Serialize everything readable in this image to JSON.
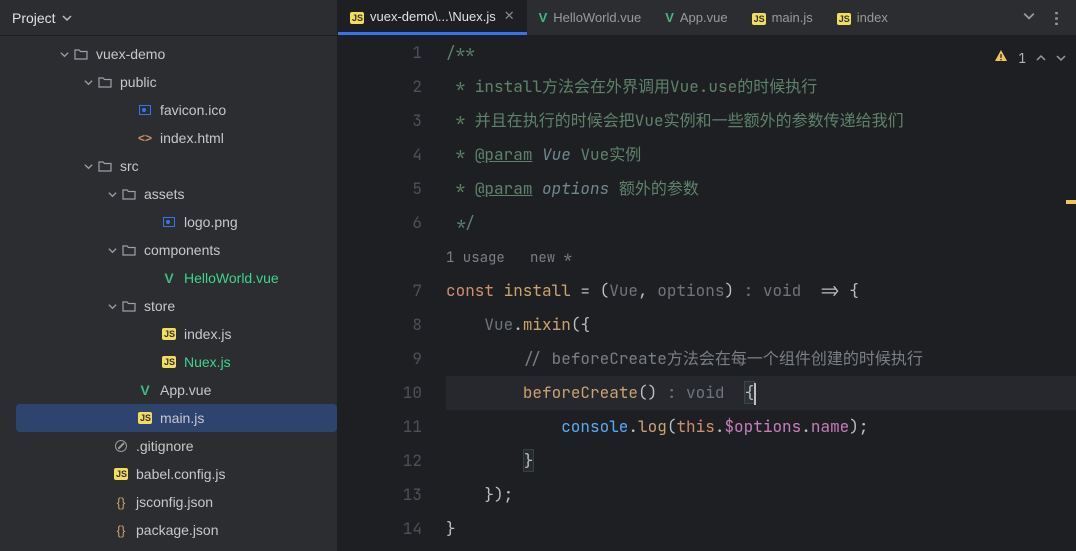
{
  "sidebar": {
    "title": "Project",
    "tree": [
      {
        "indent": 56,
        "chevron": "down",
        "icon": "folder",
        "label": "vuex-demo"
      },
      {
        "indent": 80,
        "chevron": "down",
        "icon": "folder",
        "label": "public"
      },
      {
        "indent": 120,
        "chevron": "",
        "icon": "img",
        "label": "favicon.ico"
      },
      {
        "indent": 120,
        "chevron": "",
        "icon": "html",
        "label": "index.html"
      },
      {
        "indent": 80,
        "chevron": "down",
        "icon": "folder",
        "label": "src"
      },
      {
        "indent": 104,
        "chevron": "down",
        "icon": "folder",
        "label": "assets"
      },
      {
        "indent": 144,
        "chevron": "",
        "icon": "img",
        "label": "logo.png"
      },
      {
        "indent": 104,
        "chevron": "down",
        "icon": "folder",
        "label": "components"
      },
      {
        "indent": 144,
        "chevron": "",
        "icon": "vue",
        "label": "HelloWorld.vue",
        "color": "vue"
      },
      {
        "indent": 104,
        "chevron": "down",
        "icon": "folder",
        "label": "store"
      },
      {
        "indent": 144,
        "chevron": "",
        "icon": "js",
        "label": "index.js"
      },
      {
        "indent": 144,
        "chevron": "",
        "icon": "js",
        "label": "Nuex.js",
        "color": "vue"
      },
      {
        "indent": 120,
        "chevron": "",
        "icon": "vue",
        "label": "App.vue"
      },
      {
        "indent": 120,
        "chevron": "",
        "icon": "js",
        "label": "main.js",
        "selected": true
      },
      {
        "indent": 96,
        "chevron": "",
        "icon": "gitignore",
        "label": ".gitignore"
      },
      {
        "indent": 96,
        "chevron": "",
        "icon": "js",
        "label": "babel.config.js"
      },
      {
        "indent": 96,
        "chevron": "",
        "icon": "json",
        "label": "jsconfig.json"
      },
      {
        "indent": 96,
        "chevron": "",
        "icon": "json",
        "label": "package.json"
      }
    ]
  },
  "tabs": {
    "items": [
      {
        "icon": "js",
        "label": "vuex-demo\\...\\Nuex.js",
        "active": true,
        "closeable": true
      },
      {
        "icon": "vue",
        "label": "HelloWorld.vue"
      },
      {
        "icon": "vue",
        "label": "App.vue"
      },
      {
        "icon": "js",
        "label": "main.js"
      },
      {
        "icon": "js",
        "label": "index"
      }
    ]
  },
  "status": {
    "warnings": "1"
  },
  "code": {
    "usage_hint": "1 usage   new *",
    "lines": [
      {
        "n": "1",
        "html": "<span class='c-comment'>/**</span>"
      },
      {
        "n": "2",
        "html": "<span class='c-comment'> * install方法会在外界调用Vue.use的时候执行</span>"
      },
      {
        "n": "3",
        "html": "<span class='c-comment'> * 并且在执行的时候会把Vue实例和一些额外的参数传递给我们</span>"
      },
      {
        "n": "4",
        "html": "<span class='c-comment'> * </span><span class='c-param'>@param</span><span class='c-comment'> </span><span class='c-param-type'>Vue</span><span class='c-comment'> Vue实例</span>"
      },
      {
        "n": "5",
        "html": "<span class='c-comment'> * </span><span class='c-param'>@param</span><span class='c-comment'> </span><span class='c-param-type'>options</span><span class='c-comment'> 额外的参数</span>"
      },
      {
        "n": "6",
        "html": "<span class='c-comment'> */</span>"
      },
      {
        "n": "",
        "usage": true
      },
      {
        "n": "7",
        "html": "<span class='c-keyword'>const </span><span class='c-fn'>install</span><span class='c-punc'> = (</span><span class='c-hint'>Vue</span><span class='c-punc'>, </span><span class='c-hint'>options</span><span class='c-punc'>)</span><span class='c-hint'> : void </span><span class='c-punc'> =&gt; {</span>"
      },
      {
        "n": "8",
        "html": "    <span class='c-hint'>Vue</span><span class='c-punc'>.</span><span class='c-method-y'>mixin</span><span class='c-punc'>({</span>"
      },
      {
        "n": "9",
        "html": "        <span class='c-line-comment'>// beforeCreate方法会在每一个组件创建的时候执行</span>"
      },
      {
        "n": "10",
        "highlighted": true,
        "html": "        <span class='c-method-y'>beforeCreate</span><span class='c-punc'>()</span><span class='c-hint'> : void </span><span class='c-punc'> </span><span class='c-punc bracket-match'>{</span><span class='cursor-caret'></span>"
      },
      {
        "n": "11",
        "html": "            <span class='c-call'>console</span><span class='c-punc'>.</span><span class='c-method-y'>log</span><span class='c-punc'>(</span><span class='c-this'>this</span><span class='c-punc'>.</span><span class='c-prop'>$options</span><span class='c-punc'>.</span><span class='c-prop'>name</span><span class='c-punc'>);</span>"
      },
      {
        "n": "12",
        "html": "        <span class='c-punc bracket-match'>}</span>"
      },
      {
        "n": "13",
        "html": "    <span class='c-punc'>});</span>"
      },
      {
        "n": "14",
        "html": "<span class='c-punc'>}</span>"
      }
    ]
  }
}
